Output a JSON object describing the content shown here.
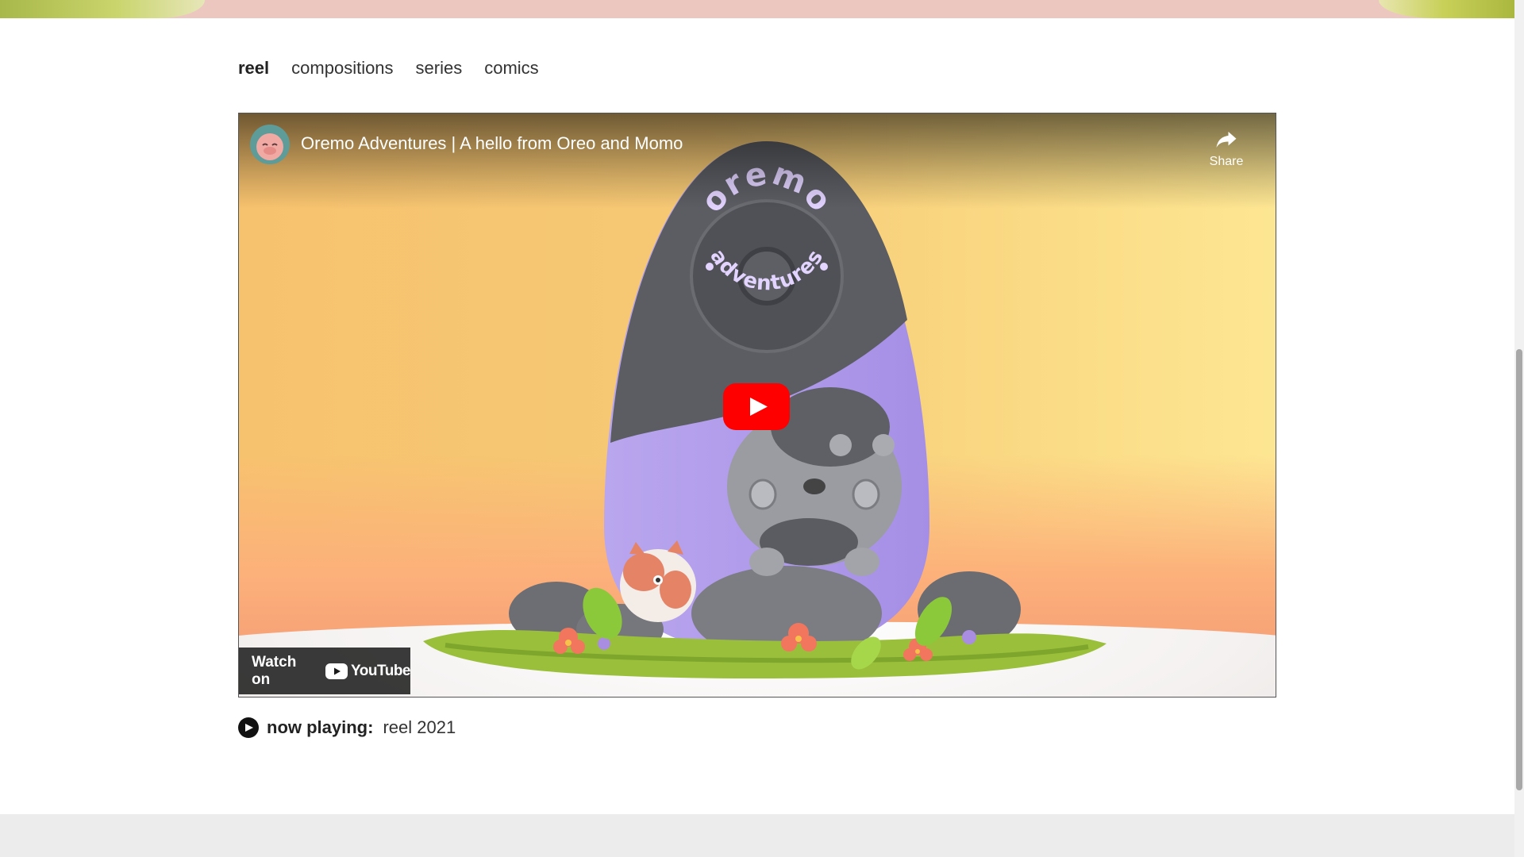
{
  "nav": {
    "tabs": [
      {
        "label": "reel",
        "active": true
      },
      {
        "label": "compositions",
        "active": false
      },
      {
        "label": "series",
        "active": false
      },
      {
        "label": "comics",
        "active": false
      }
    ]
  },
  "video": {
    "title": "Oremo Adventures | A hello from Oreo and Momo",
    "share_label": "Share",
    "watch_on_label": "Watch on",
    "youtube_label": "YouTube",
    "sign_text_top": "oremo",
    "sign_text_bottom": "adventures",
    "play_icon": "play-icon",
    "brand_red": "#ff0000"
  },
  "now_playing": {
    "label": "now playing:",
    "value": "reel 2021"
  }
}
